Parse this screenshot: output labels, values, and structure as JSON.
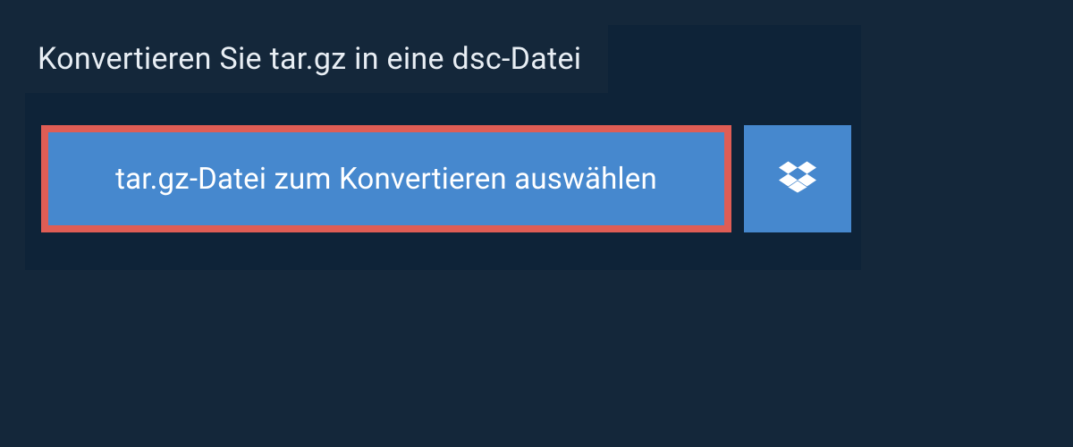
{
  "header": {
    "title": "Konvertieren Sie tar.gz in eine dsc-Datei"
  },
  "actions": {
    "select_file_label": "tar.gz-Datei zum Konvertieren auswählen"
  },
  "colors": {
    "page_bg": "#14273a",
    "panel_bg": "#0e2338",
    "button_bg": "#4688ce",
    "highlight_border": "#df5d55",
    "text_light": "#ffffff"
  }
}
